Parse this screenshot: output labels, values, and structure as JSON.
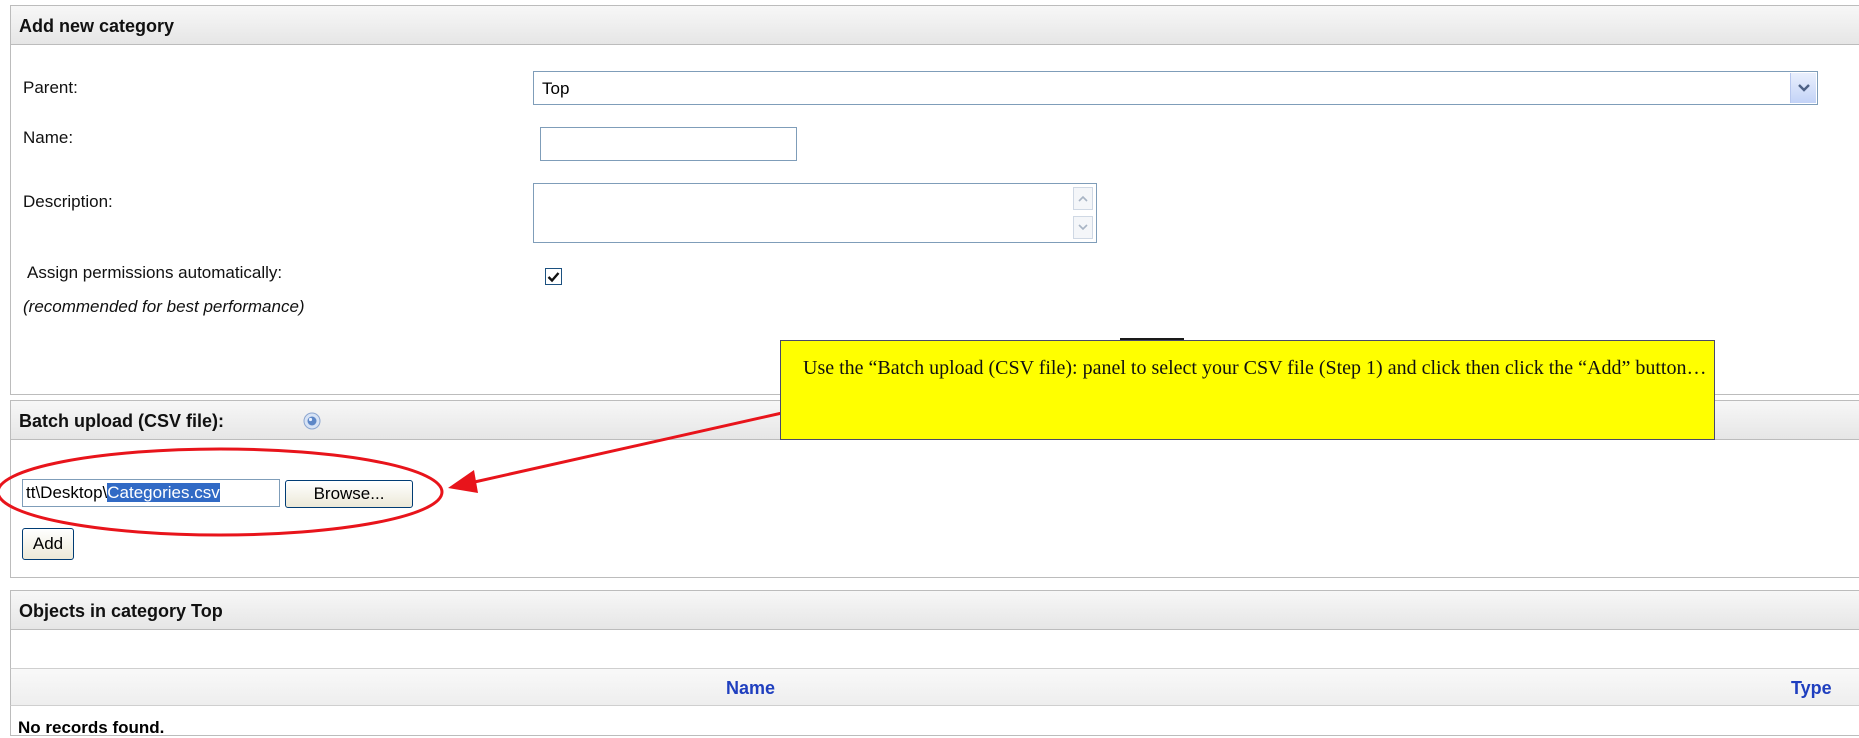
{
  "add_panel": {
    "title": "Add new category",
    "parent_label": "Parent:",
    "parent_value": "Top",
    "name_label": "Name:",
    "name_value": "",
    "description_label": "Description:",
    "description_value": "",
    "assign_label": "Assign permissions automatically:",
    "assign_note": "(recommended for best performance)",
    "assign_checked": true
  },
  "batch_panel": {
    "title": "Batch upload (CSV file):",
    "file_path_prefix": "tt\\Desktop\\",
    "file_path_selected": "Categories.csv",
    "browse_label": "Browse...",
    "add_label": "Add"
  },
  "objects_panel": {
    "title": "Objects in category Top",
    "columns": [
      "Name",
      "Type"
    ],
    "empty_text": "No records found."
  },
  "callout": {
    "text": "Use the “Batch upload (CSV file): panel to select your CSV file (Step 1) and click then click the “Add” button…"
  },
  "colors": {
    "callout_bg": "#ffff00",
    "annotation_red": "#e8141b",
    "header_link_blue": "#1f3fbf",
    "selection_blue": "#316ac5"
  }
}
